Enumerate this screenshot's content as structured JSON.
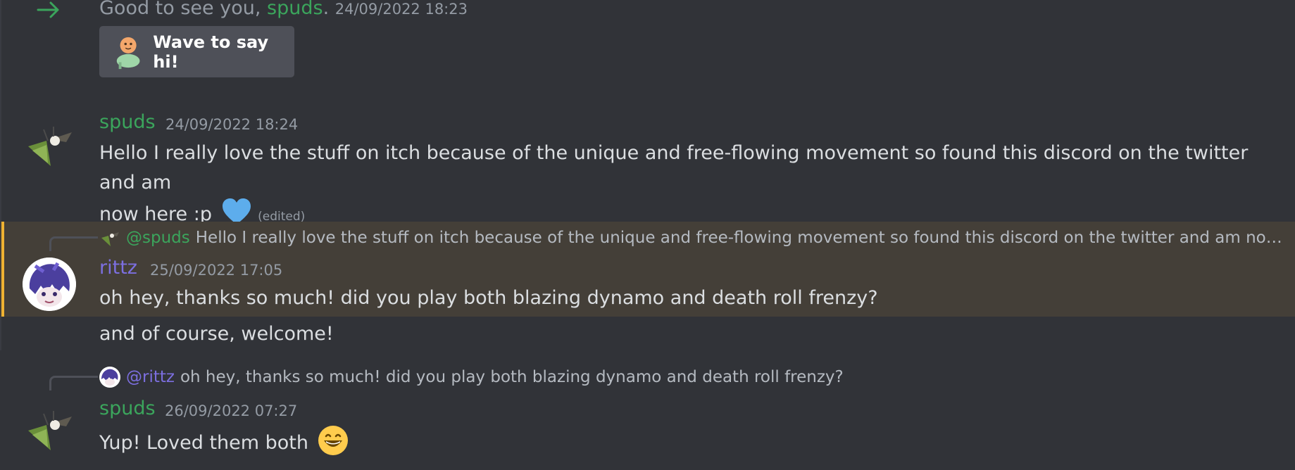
{
  "colors": {
    "background": "#313338",
    "green_user": "#3ba55c",
    "purple_user": "#7c6fe0",
    "highlight": "#443f38",
    "highlight_bar": "#f0b232",
    "wave_button": "#4e5058"
  },
  "join": {
    "icon": "join-arrow-icon",
    "prefix": "Good to see you, ",
    "user": "spuds",
    "suffix": ".",
    "timestamp": "24/09/2022 18:23",
    "wave_button_label": "Wave to say hi!"
  },
  "messages": [
    {
      "author": "spuds",
      "timestamp": "24/09/2022 18:24",
      "lines": [
        "Hello I really love the stuff on itch because of the unique and free-flowing movement so found this discord on the twitter and am",
        "now here :p"
      ],
      "emoji": "blue-heart-icon",
      "edited": "(edited)"
    },
    {
      "author": "rittz",
      "timestamp": "25/09/2022 17:05",
      "reply": {
        "mention": "@spuds",
        "text": "Hello I really love the stuff on itch because of the unique and free-flowing movement so found this discord on the twitter and am now h..."
      },
      "text": "oh hey, thanks so much! did you play both blazing dynamo and death roll frenzy?",
      "followup": "and of course, welcome!",
      "highlighted": true
    },
    {
      "author": "spuds",
      "timestamp": "26/09/2022 07:27",
      "reply": {
        "mention": "@rittz",
        "text": "oh hey, thanks so much! did you play both blazing dynamo and death roll frenzy?"
      },
      "text": "Yup! Loved them both",
      "emoji": "grinning-face-icon"
    }
  ]
}
